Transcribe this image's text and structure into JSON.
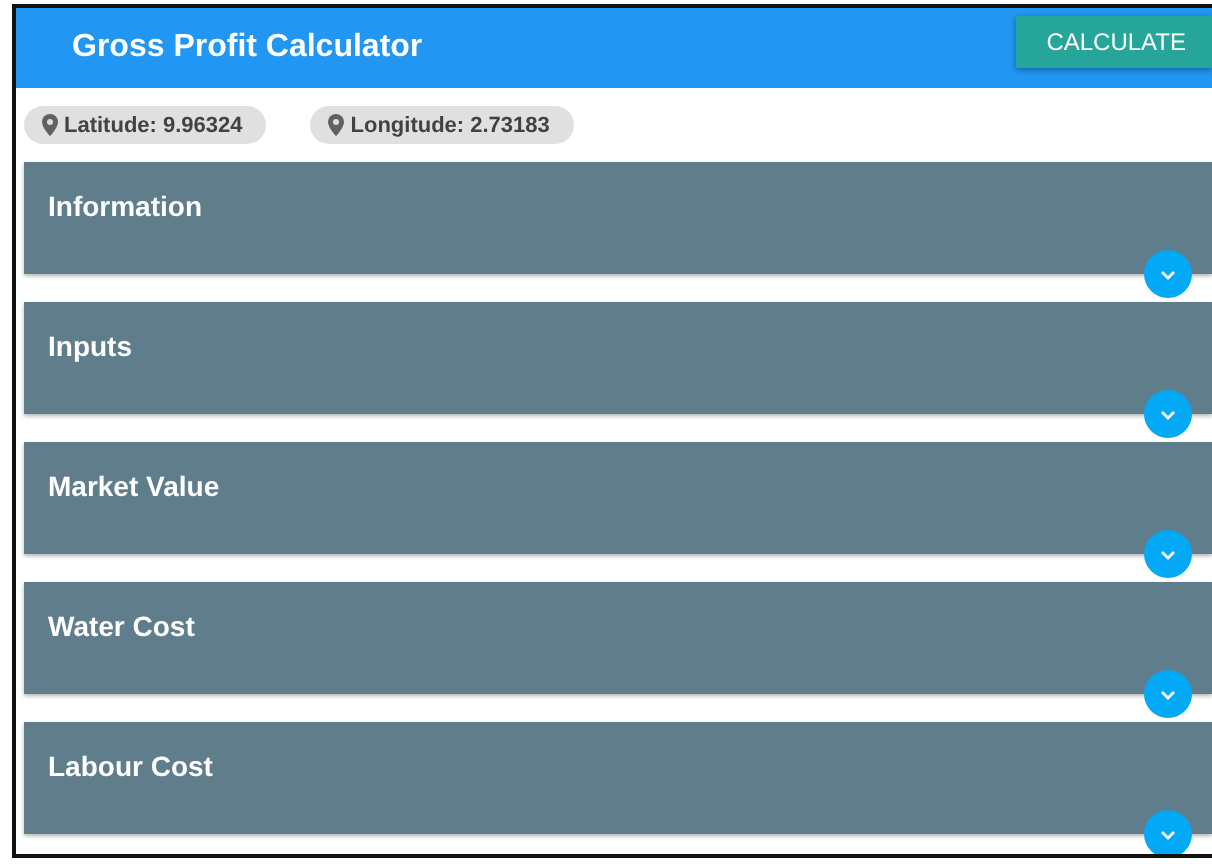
{
  "app_bar": {
    "title": "Gross Profit Calculator",
    "action": "CALCULATE"
  },
  "location_chips": [
    {
      "label": "Latitude: 9.96324"
    },
    {
      "label": "Longitude: 2.73183"
    }
  ],
  "sections": [
    {
      "title": "Information",
      "expanded": false
    },
    {
      "title": "Inputs",
      "expanded": false
    },
    {
      "title": "Market Value",
      "expanded": false
    },
    {
      "title": "Water Cost",
      "expanded": false
    },
    {
      "title": "Labour Cost",
      "expanded": false
    }
  ]
}
